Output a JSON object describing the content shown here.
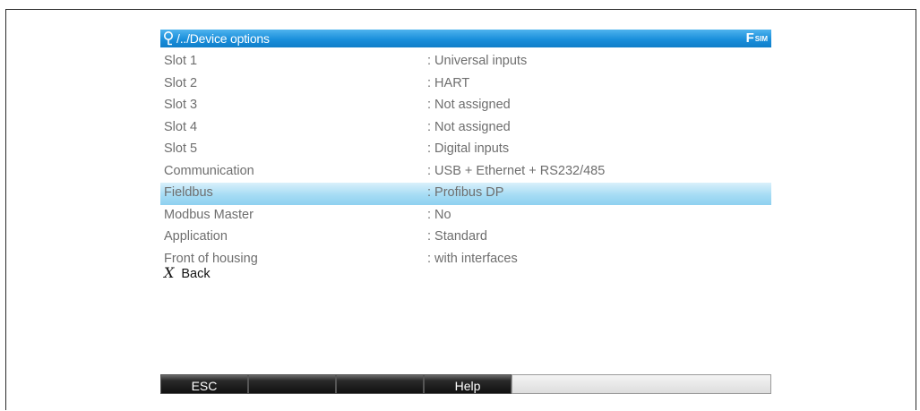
{
  "header": {
    "path": "/../Device options",
    "badge_main": "F",
    "badge_sub": "SIM"
  },
  "rows": [
    {
      "label": "Slot 1",
      "value": ": Universal inputs",
      "selected": false
    },
    {
      "label": "Slot 2",
      "value": ": HART",
      "selected": false
    },
    {
      "label": "Slot 3",
      "value": ": Not assigned",
      "selected": false
    },
    {
      "label": "Slot 4",
      "value": ": Not assigned",
      "selected": false
    },
    {
      "label": "Slot 5",
      "value": ": Digital inputs",
      "selected": false
    },
    {
      "label": "Communication",
      "value": ": USB + Ethernet + RS232/485",
      "selected": false
    },
    {
      "label": "Fieldbus",
      "value": ": Profibus DP",
      "selected": true
    },
    {
      "label": "Modbus Master",
      "value": ": No",
      "selected": false
    },
    {
      "label": "Application",
      "value": ": Standard",
      "selected": false
    },
    {
      "label": "Front of housing",
      "value": ": with interfaces",
      "selected": false
    }
  ],
  "back": {
    "icon": "X",
    "label": "Back"
  },
  "softkeys": [
    "ESC",
    "",
    "",
    "Help",
    ""
  ],
  "colors": {
    "header": "#1a8fdb",
    "selected_row": "#a6dcf4",
    "row_text": "#6e6e6e"
  }
}
